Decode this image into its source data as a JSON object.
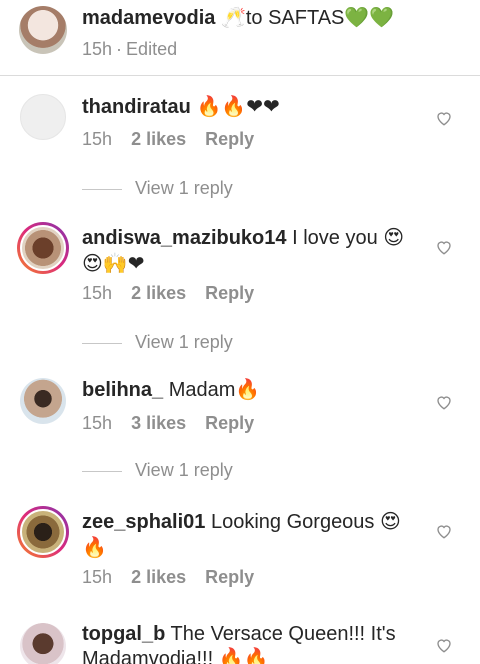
{
  "caption": {
    "username": "madamevodia",
    "text": "🥂to SAFTAS💚💚",
    "time": "15h",
    "edited": "Edited"
  },
  "comments": [
    {
      "username": "thandiratau",
      "text": "🔥🔥❤❤",
      "time": "15h",
      "likes": "2 likes",
      "reply": "Reply",
      "view_replies": "View 1 reply"
    },
    {
      "username": "andiswa_mazibuko14",
      "text": "I love you 😍",
      "text2": "😍🙌❤",
      "time": "15h",
      "likes": "2 likes",
      "reply": "Reply",
      "view_replies": "View 1 reply"
    },
    {
      "username": "belihna_",
      "text": "Madam🔥",
      "time": "15h",
      "likes": "3 likes",
      "reply": "Reply",
      "view_replies": "View 1 reply"
    },
    {
      "username": "zee_sphali01",
      "text": "Looking Gorgeous 😍",
      "text2": "🔥",
      "time": "15h",
      "likes": "2 likes",
      "reply": "Reply"
    },
    {
      "username": "topgal_b",
      "text": "The Versace Queen!!! It's",
      "text2": "Madamvodia!!! 🔥🔥"
    }
  ],
  "colors": {
    "text": "#262626",
    "muted": "#8e8e8e",
    "divider": "#dbdbdb"
  }
}
